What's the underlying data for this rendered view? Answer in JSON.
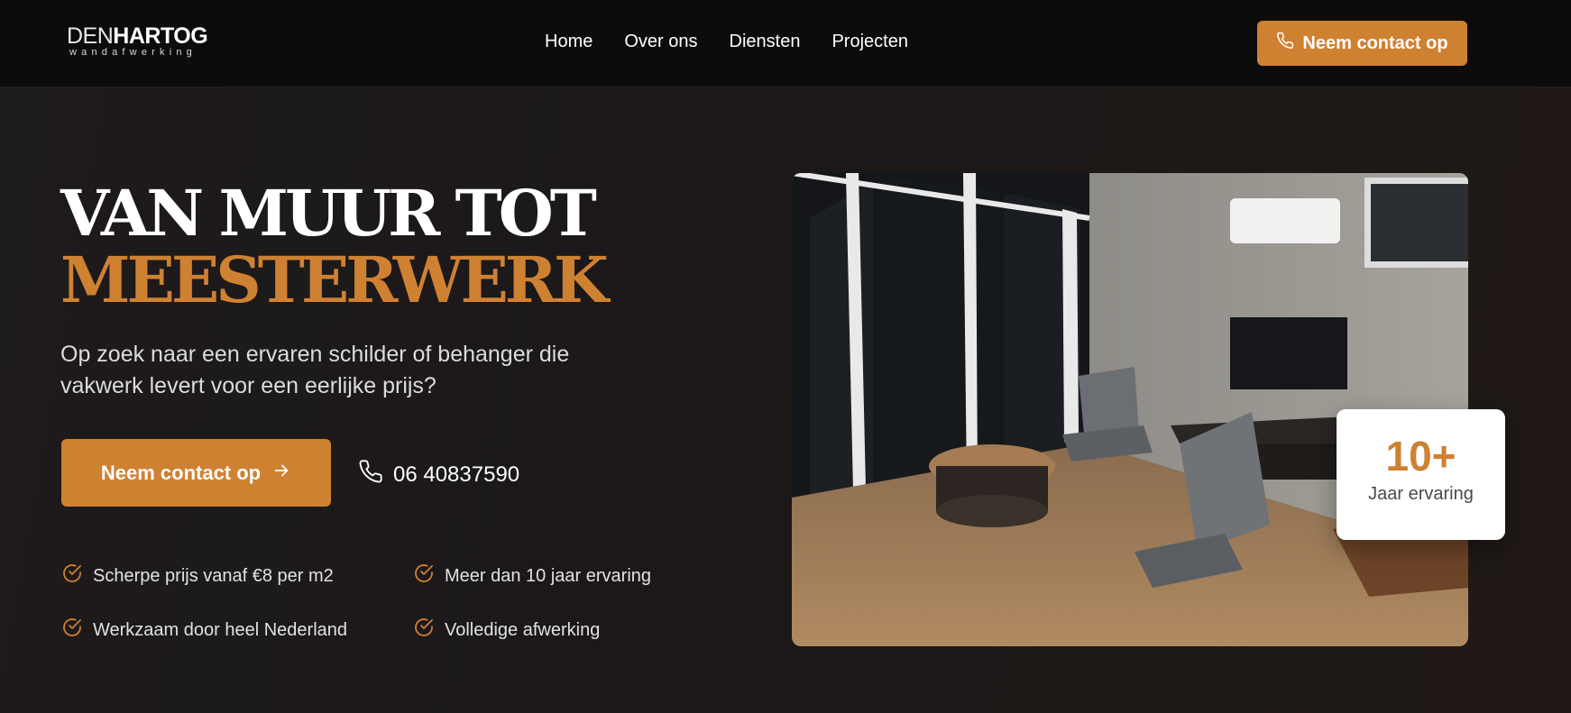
{
  "header": {
    "logo": {
      "den": "DEN",
      "hartog": "HARTOG",
      "sub": "wandafwerking"
    },
    "nav": [
      "Home",
      "Over ons",
      "Diensten",
      "Projecten"
    ],
    "cta_label": "Neem contact op"
  },
  "hero": {
    "headline_line1": "VAN MUUR TOT",
    "headline_line2": "MEESTERWERK",
    "subtitle": "Op zoek naar een ervaren schilder of behanger die vakwerk levert voor een eerlijke prijs?",
    "cta_label": "Neem contact op",
    "phone": "06 40837590",
    "features": [
      "Scherpe prijs vanaf €8 per m2",
      "Meer dan 10 jaar ervaring",
      "Werkzaam door heel Nederland",
      "Volledige afwerking"
    ],
    "badge": {
      "number": "10+",
      "label": "Jaar ervaring"
    }
  },
  "icons": {
    "phone": "phone-icon",
    "arrow": "arrow-right-icon",
    "check": "check-circle-icon"
  },
  "colors": {
    "accent": "#cf8132",
    "header_bg": "#0d0c0d",
    "page_bg": "#1e1b1c",
    "text": "#ffffff"
  }
}
